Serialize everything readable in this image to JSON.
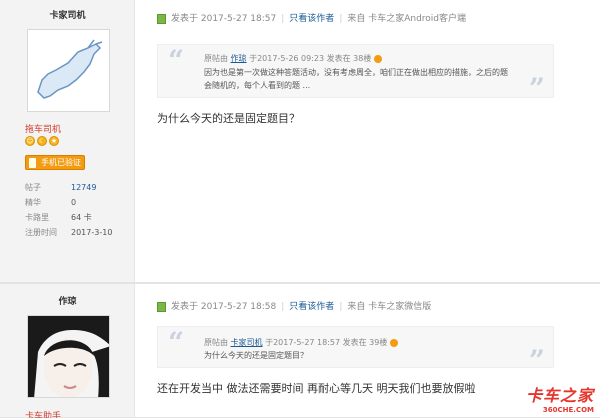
{
  "posts": [
    {
      "username": "卡家司机",
      "rank": "拖车司机",
      "badge": "手机已验证",
      "stats": [
        {
          "label": "帖子",
          "value": "12749"
        },
        {
          "label": "精华",
          "value": "0"
        },
        {
          "label": "卡路里",
          "value": "64 卡"
        },
        {
          "label": "注册时间",
          "value": "2017-3-10"
        }
      ],
      "meta": {
        "posted": "发表于 2017-5-27 18:57",
        "only_author": "只看该作者",
        "source": "来自 卡车之家Android客户端"
      },
      "quote": {
        "prefix": "原帖由",
        "author": "作琼",
        "info": "于2017-5-26 09:23 发表在 38楼",
        "lines": [
          "因为也是第一次做这种答题活动，没有考虑周全，咱们正在做出相应的措施，之后的题",
          "会随机的，每个人看到的题 ..."
        ]
      },
      "content": "为什么今天的还是固定题目？"
    },
    {
      "username": "作琼",
      "rank": "卡车助手",
      "meta": {
        "posted": "发表于 2017-5-27 18:58",
        "only_author": "只看该作者",
        "source": "来自 卡车之家微信版"
      },
      "quote": {
        "prefix": "原帖由",
        "author": "卡家司机",
        "info": "于2017-5-27 18:57 发表在 39楼",
        "lines": [
          "为什么今天的还是固定题目？"
        ]
      },
      "content": "还在开发当中 做法还需要时间 再耐心等几天 明天我们也要放假啦"
    }
  ],
  "watermark": {
    "brand": "卡车之家",
    "url": "360CHE.COM"
  }
}
